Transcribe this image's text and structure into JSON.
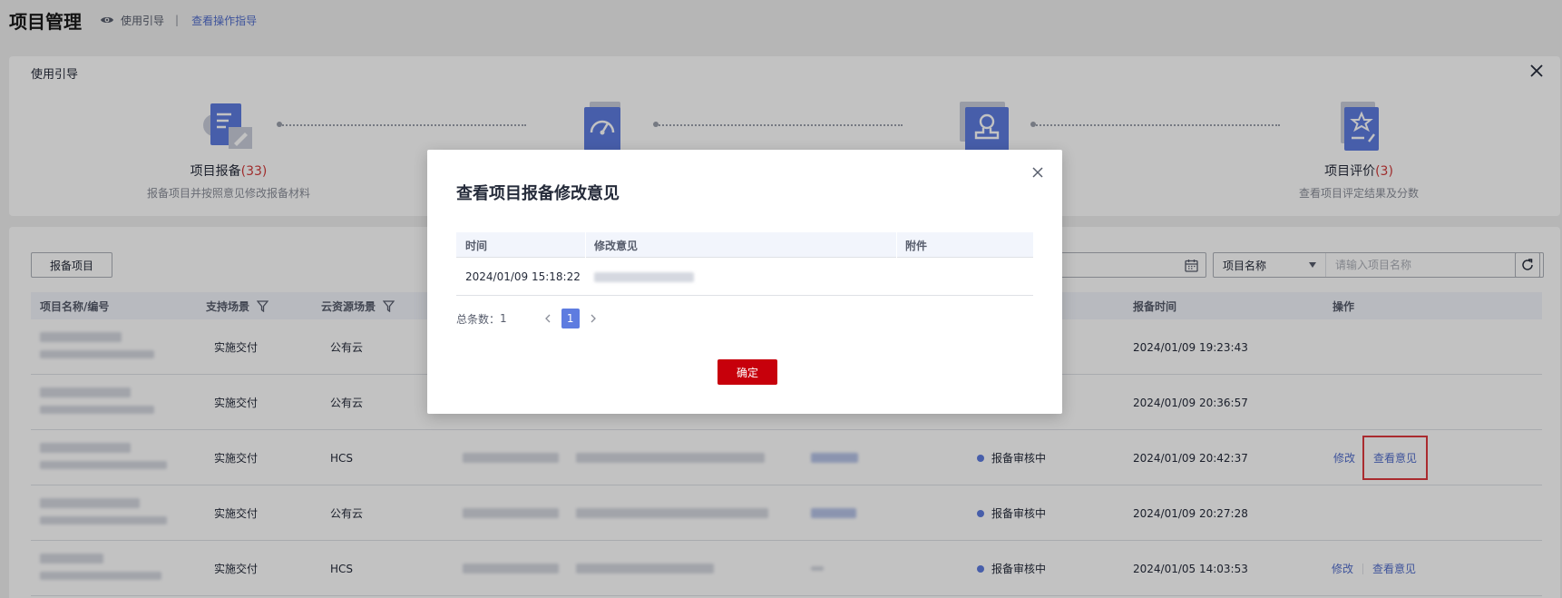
{
  "header": {
    "title": "项目管理",
    "guide_toggle_label": "使用引导",
    "separator": "|",
    "guide_link_label": "查看操作指导"
  },
  "guide": {
    "title": "使用引导",
    "steps": [
      {
        "title": "项目报备",
        "count": "(33)",
        "desc": "报备项目并按照意见修改报备材料",
        "icon": "document-edit-icon"
      },
      {
        "title": "",
        "count": "",
        "desc": "",
        "icon": "gauge-document-icon"
      },
      {
        "title": "",
        "count": "",
        "desc": "",
        "icon": "stamp-approval-icon"
      },
      {
        "title": "项目评价",
        "count": "(3)",
        "desc": "查看项目评定结果及分数",
        "icon": "star-document-icon"
      }
    ]
  },
  "toolbar": {
    "report_button_label": "报备项目",
    "search_field_select": "项目名称",
    "search_placeholder": "请输入项目名称"
  },
  "table": {
    "columns": {
      "name": "项目名称/编号",
      "scene": "支持场景",
      "cloud": "云资源场景",
      "report_time": "报备时间",
      "actions": "操作"
    },
    "rows": [
      {
        "scene": "实施交付",
        "cloud": "公有云",
        "status": "",
        "time": "2024/01/09 19:23:43",
        "actions": []
      },
      {
        "scene": "实施交付",
        "cloud": "公有云",
        "status": "",
        "time": "2024/01/09 20:36:57",
        "actions": []
      },
      {
        "scene": "实施交付",
        "cloud": "HCS",
        "status": "报备审核中",
        "time": "2024/01/09 20:42:37",
        "actions": [
          "修改",
          "查看意见"
        ]
      },
      {
        "scene": "实施交付",
        "cloud": "公有云",
        "status": "报备审核中",
        "time": "2024/01/09 20:27:28",
        "actions": []
      },
      {
        "scene": "实施交付",
        "cloud": "HCS",
        "status": "报备审核中",
        "time": "2024/01/05 14:03:53",
        "actions": [
          "修改",
          "查看意见"
        ]
      }
    ]
  },
  "modal": {
    "title": "查看项目报备修改意见",
    "columns": {
      "time": "时间",
      "opinion": "修改意见",
      "attachment": "附件"
    },
    "rows": [
      {
        "time": "2024/01/09 15:18:22"
      }
    ],
    "pager": {
      "total_label": "总条数：",
      "total": "1",
      "current_page": "1"
    },
    "confirm_label": "确定"
  },
  "colors": {
    "accent": "#526ecc",
    "primary_blue": "#5e7ce0",
    "confirm_red": "#c7000b",
    "highlight_red": "#e0393e",
    "count_red": "#d23b3b"
  }
}
